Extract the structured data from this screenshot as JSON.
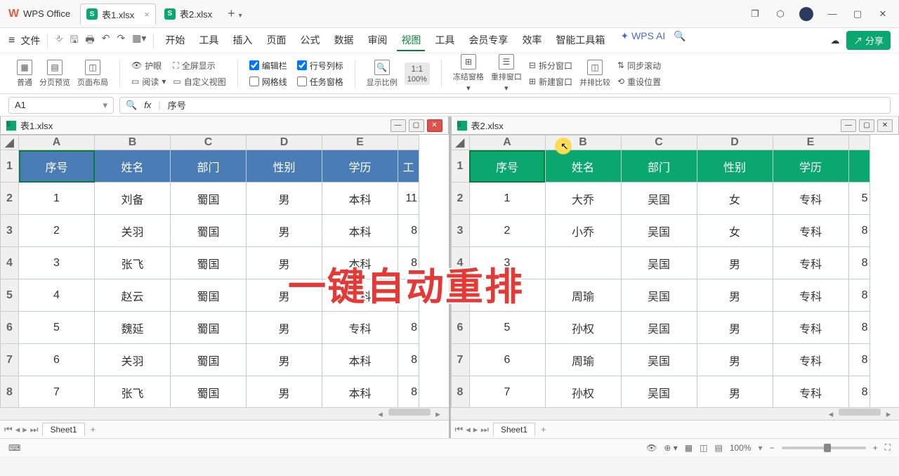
{
  "app": {
    "name": "WPS Office"
  },
  "tabs": [
    {
      "label": "表1.xlsx",
      "active": true
    },
    {
      "label": "表2.xlsx",
      "active": false
    }
  ],
  "menu": {
    "file": "文件",
    "items": [
      "开始",
      "工具",
      "插入",
      "页面",
      "公式",
      "数据",
      "审阅",
      "视图",
      "工具",
      "会员专享",
      "效率",
      "智能工具箱"
    ],
    "active_index": 7,
    "ai": "WPS AI",
    "share": "分享"
  },
  "ribbon": {
    "view_modes": [
      "普通",
      "分页预览",
      "页面布局"
    ],
    "eye": "护眼",
    "fullscreen": "全屏显示",
    "read": "阅读",
    "custom_view": "自定义视图",
    "checks": {
      "edit_bar": "编辑栏",
      "rowcol_label": "行号列标",
      "gridlines": "网格线",
      "task_pane": "任务窗格"
    },
    "zoom_label": "显示比例",
    "zoom_value": "100%",
    "freeze": "冻结窗格",
    "rearrange": "重排窗口",
    "split": "拆分窗口",
    "new_window": "新建窗口",
    "side_by_side": "并排比较",
    "sync_scroll": "同步滚动",
    "reset_pos": "重设位置"
  },
  "formula": {
    "cell": "A1",
    "fx": "fx",
    "value": "序号"
  },
  "pane1": {
    "title": "表1.xlsx",
    "columns": [
      "A",
      "B",
      "C",
      "D",
      "E"
    ],
    "headers": [
      "序号",
      "姓名",
      "部门",
      "性别",
      "学历"
    ],
    "header_extra": "工",
    "rows": [
      [
        "1",
        "刘备",
        "蜀国",
        "男",
        "本科",
        "11"
      ],
      [
        "2",
        "关羽",
        "蜀国",
        "男",
        "本科",
        "8"
      ],
      [
        "3",
        "张飞",
        "蜀国",
        "男",
        "本科",
        "8"
      ],
      [
        "4",
        "赵云",
        "蜀国",
        "男",
        "本科",
        "8"
      ],
      [
        "5",
        "魏延",
        "蜀国",
        "男",
        "专科",
        "8"
      ],
      [
        "6",
        "关羽",
        "蜀国",
        "男",
        "本科",
        "8"
      ],
      [
        "7",
        "张飞",
        "蜀国",
        "男",
        "本科",
        "8"
      ]
    ],
    "sheet": "Sheet1"
  },
  "pane2": {
    "title": "表2.xlsx",
    "columns": [
      "A",
      "B",
      "C",
      "D",
      "E"
    ],
    "headers": [
      "序号",
      "姓名",
      "部门",
      "性别",
      "学历"
    ],
    "rows": [
      [
        "1",
        "大乔",
        "吴国",
        "女",
        "专科",
        "5"
      ],
      [
        "2",
        "小乔",
        "吴国",
        "女",
        "专科",
        "8"
      ],
      [
        "3",
        "",
        "吴国",
        "男",
        "专科",
        "8"
      ],
      [
        "4",
        "周瑜",
        "吴国",
        "男",
        "专科",
        "8"
      ],
      [
        "5",
        "孙权",
        "吴国",
        "男",
        "专科",
        "8"
      ],
      [
        "6",
        "周瑜",
        "吴国",
        "男",
        "专科",
        "8"
      ],
      [
        "7",
        "孙权",
        "吴国",
        "男",
        "专科",
        "8"
      ]
    ],
    "sheet": "Sheet1"
  },
  "overlay": "一键自动重排",
  "status": {
    "zoom": "100%"
  }
}
